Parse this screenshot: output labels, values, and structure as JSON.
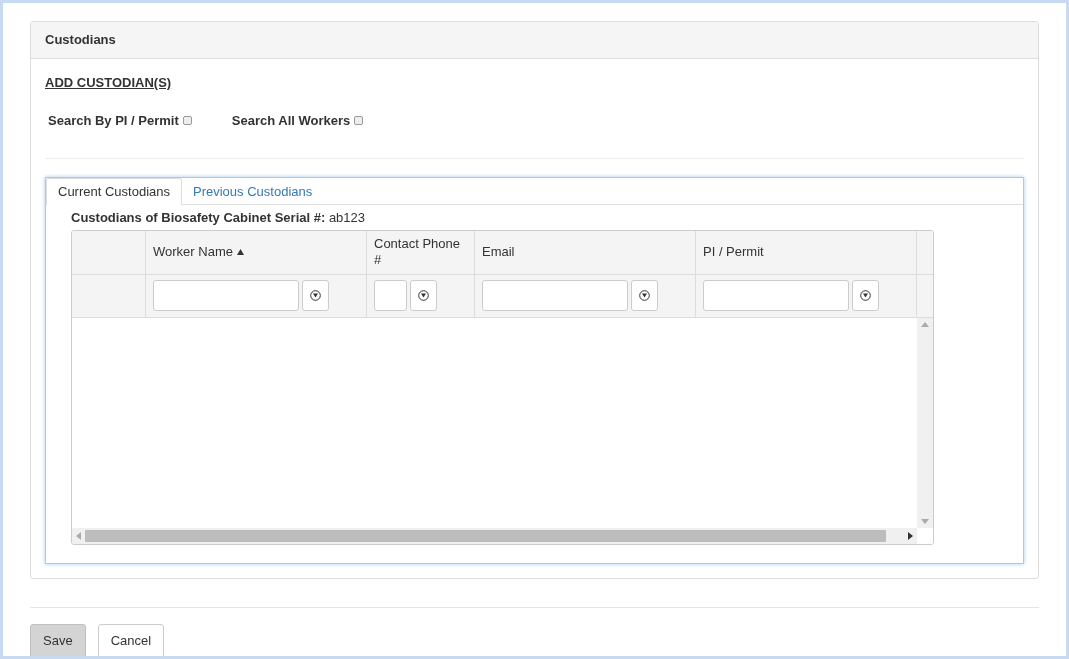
{
  "panel": {
    "title": "Custodians"
  },
  "add_link": "ADD CUSTODIAN(S)",
  "search_options": [
    {
      "label": "Search By PI / Permit",
      "checked": false
    },
    {
      "label": "Search All Workers",
      "checked": false
    }
  ],
  "tabs": [
    {
      "label": "Current Custodians",
      "selected": true
    },
    {
      "label": "Previous Custodians",
      "selected": false
    }
  ],
  "caption": {
    "label": "Custodians of Biosafety Cabinet Serial #:",
    "value": "ab123"
  },
  "table": {
    "columns": [
      {
        "label": "Worker Name",
        "sorted": true
      },
      {
        "label": "Contact Phone #",
        "sorted": false
      },
      {
        "label": "Email",
        "sorted": false
      },
      {
        "label": "PI / Permit",
        "sorted": false
      }
    ]
  },
  "buttons": [
    {
      "label": "Save",
      "kind": "shaded"
    },
    {
      "label": "Cancel",
      "kind": "plain"
    }
  ]
}
